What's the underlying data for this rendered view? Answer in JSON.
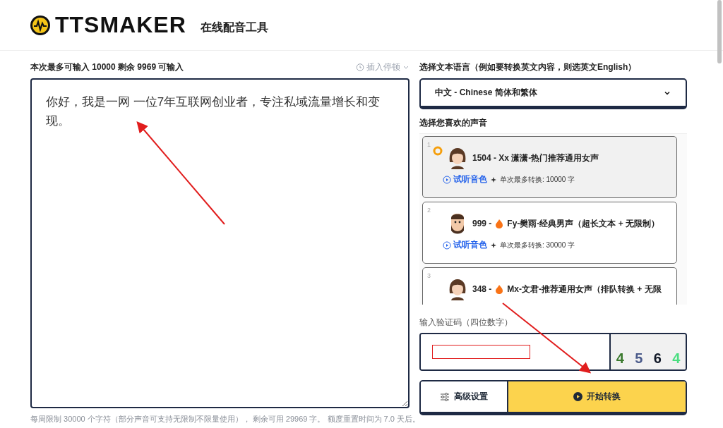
{
  "header": {
    "logo": "TTSMAKER",
    "subtitle": "在线配音工具"
  },
  "editor": {
    "limit_text": "本次最多可输入 10000 剩余 9969 可输入",
    "pause_button": "插入停顿",
    "value": "你好，我是一网 一位7年互联网创业者，专注私域流量增长和变现。",
    "footer_note": "每周限制 30000 个字符（部分声音可支持无限制不限量使用）， 剩余可用 29969 字。 额度重置时间为 7.0 天后。"
  },
  "language": {
    "label": "选择文本语言（例如要转换英文内容，则选英文English）",
    "selected": "中文 - Chinese 简体和繁体"
  },
  "voices": {
    "label": "选择您喜欢的声音",
    "items": [
      {
        "index": "1",
        "kind": "female",
        "hot": false,
        "selected": true,
        "title": "1504 - Xx 潇潇-热门推荐通用女声",
        "preview": "试听音色",
        "limit": "单次最多转换: 10000 字"
      },
      {
        "index": "2",
        "kind": "male",
        "hot": true,
        "selected": false,
        "title": "Fy-樊雨-经典男声（超长文本 + 无限制）",
        "number": "999 -",
        "preview": "试听音色",
        "limit": "单次最多转换: 30000 字"
      },
      {
        "index": "3",
        "kind": "female",
        "hot": true,
        "selected": false,
        "title": "Mx-文君-推荐通用女声（排队转换 + 无限",
        "number": "348 -"
      }
    ]
  },
  "captcha": {
    "label": "输入验证码（四位数字）",
    "digits": [
      "4",
      "5",
      "6",
      "4"
    ]
  },
  "buttons": {
    "advanced": "高级设置",
    "start": "开始转换"
  }
}
